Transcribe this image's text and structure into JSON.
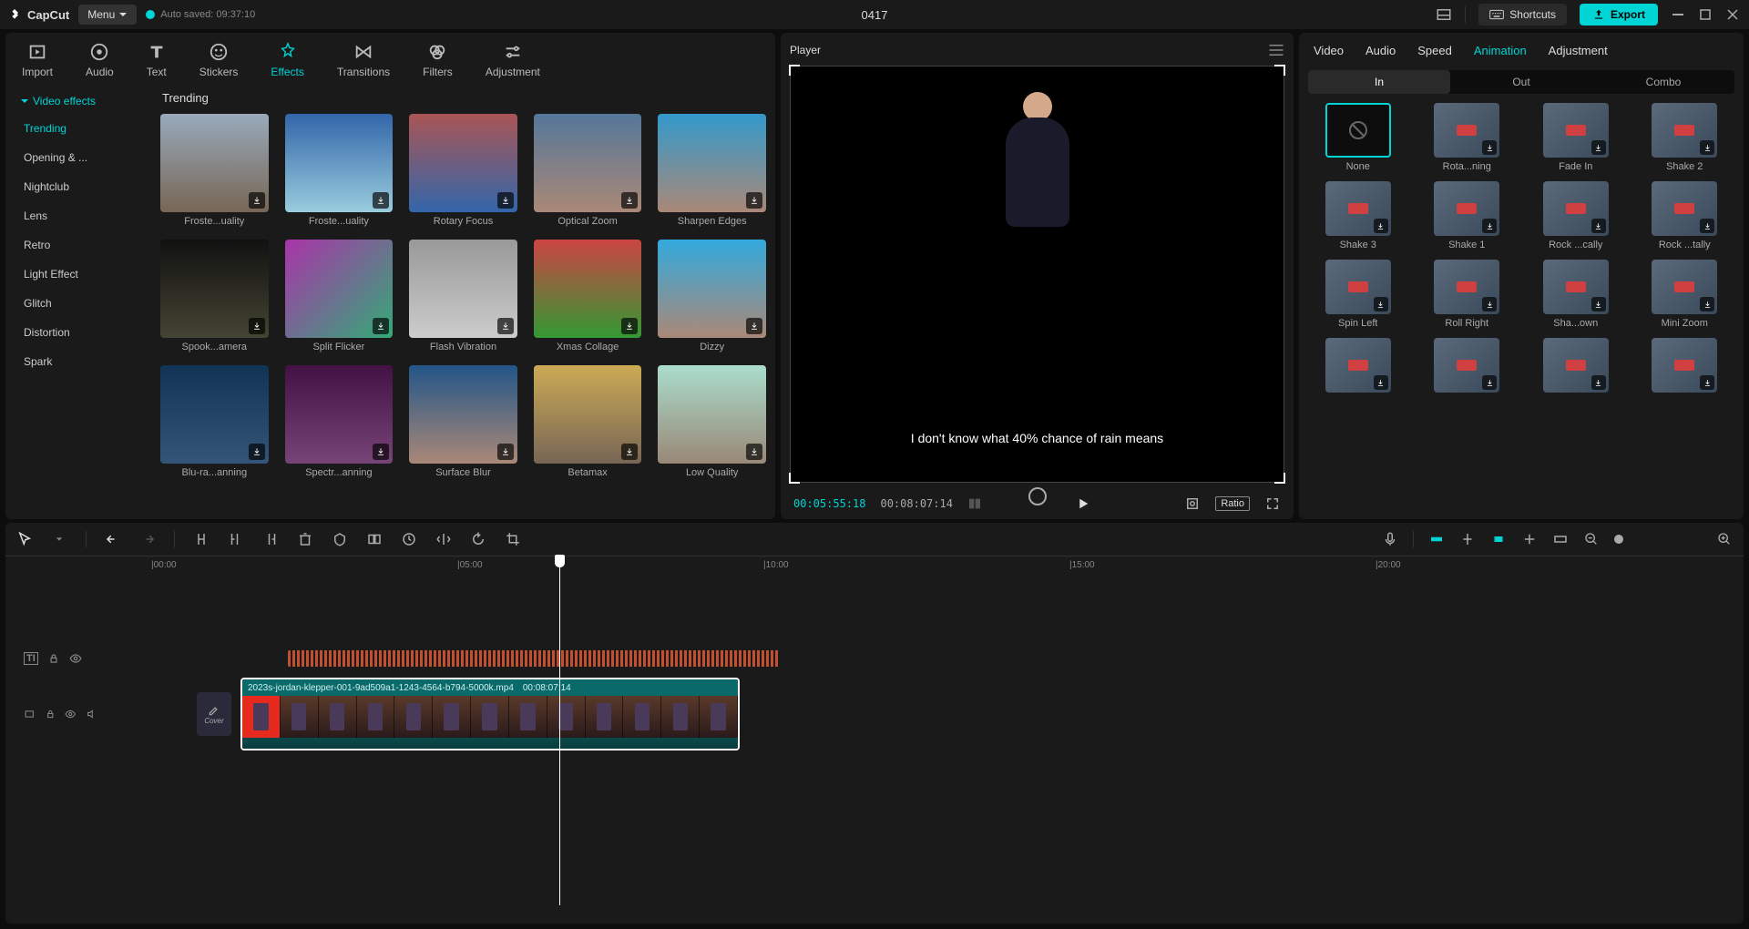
{
  "app": {
    "name": "CapCut",
    "menu": "Menu",
    "autosave": "Auto saved: 09:37:10",
    "title": "0417",
    "shortcuts": "Shortcuts",
    "export": "Export"
  },
  "mediaTabs": [
    "Import",
    "Audio",
    "Text",
    "Stickers",
    "Effects",
    "Transitions",
    "Filters",
    "Adjustment"
  ],
  "effCat": {
    "head": "Video effects",
    "items": [
      "Trending",
      "Opening & ...",
      "Nightclub",
      "Lens",
      "Retro",
      "Light Effect",
      "Glitch",
      "Distortion",
      "Spark"
    ]
  },
  "effTitle": "Trending",
  "effects": [
    "Froste...uality",
    "Froste...uality",
    "Rotary Focus",
    "Optical Zoom",
    "Sharpen Edges",
    "Spook...amera",
    "Split Flicker",
    "Flash Vibration",
    "Xmas Collage",
    "Dizzy",
    "Blu-ra...anning",
    "Spectr...anning",
    "Surface Blur",
    "Betamax",
    "Low Quality"
  ],
  "player": {
    "label": "Player",
    "caption": "I don't know what 40% chance of rain means",
    "tc1": "00:05:55:18",
    "tc2": "00:08:07:14",
    "ratio": "Ratio"
  },
  "propTabs": [
    "Video",
    "Audio",
    "Speed",
    "Animation",
    "Adjustment"
  ],
  "subTabs": [
    "In",
    "Out",
    "Combo"
  ],
  "anims": [
    "None",
    "Rota...ning",
    "Fade In",
    "Shake 2",
    "Shake 3",
    "Shake 1",
    "Rock ...cally",
    "Rock ...tally",
    "Spin Left",
    "Roll Right",
    "Sha...own",
    "Mini Zoom",
    "",
    "",
    "",
    ""
  ],
  "ruler": [
    "|00:00",
    "|05:00",
    "|10:00",
    "|15:00",
    "|20:00"
  ],
  "clip": {
    "file": "2023s-jordan-klepper-001-9ad509a1-1243-4564-b794-5000k.mp4",
    "dur": "00:08:07:14"
  },
  "cover": "Cover"
}
